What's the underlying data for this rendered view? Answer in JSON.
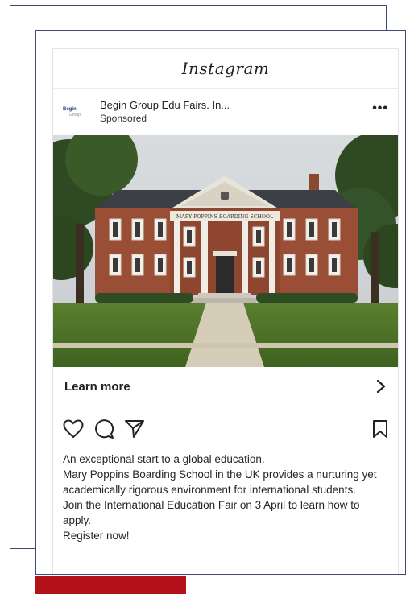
{
  "platform": {
    "title": "Instagram"
  },
  "post": {
    "account_name": "Begin Group Edu Fairs. In...",
    "account_status": "Sponsored",
    "avatar_text": "Begin",
    "avatar_subtext": "Group",
    "more_label": "•••",
    "image_sign": "MARY POPPINS BOARDING SCHOOL",
    "cta_label": "Learn more",
    "caption": [
      "An exceptional start to a global education.",
      "Mary Poppins Boarding School in the UK provides a nurturing yet academically rigorous environment for international students.",
      "Join the International Education Fair on 3 April to learn how to apply.",
      "Register now!"
    ]
  },
  "icons": [
    "heart-icon",
    "comment-icon",
    "share-icon",
    "bookmark-icon",
    "chevron-right-icon",
    "more-icon"
  ],
  "colors": {
    "frame": "#3f4a7a",
    "accent_bar": "#b3121b",
    "text": "#262626"
  }
}
